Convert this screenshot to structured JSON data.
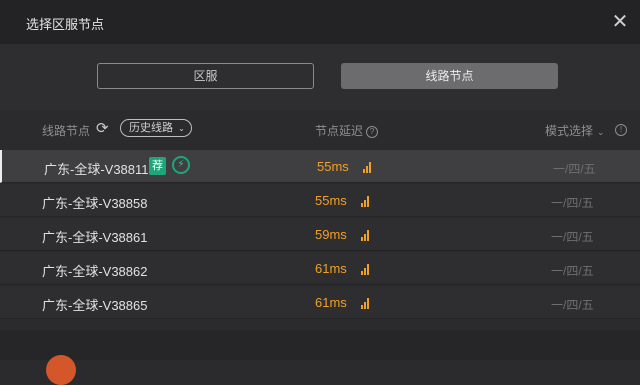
{
  "window": {
    "title": "选择区服节点"
  },
  "tabs": [
    {
      "label": "区服"
    },
    {
      "label": "线路节点"
    }
  ],
  "table": {
    "header": {
      "nodes": "线路节点",
      "history": "历史线路",
      "latency": "节点延迟",
      "mode": "模式选择"
    },
    "rows": [
      {
        "name": "广东-全球-V38811",
        "latency": "55ms",
        "mode": "一/四/五",
        "badge": "荐"
      },
      {
        "name": "广东-全球-V38858",
        "latency": "55ms",
        "mode": "一/四/五"
      },
      {
        "name": "广东-全球-V38861",
        "latency": "59ms",
        "mode": "一/四/五"
      },
      {
        "name": "广东-全球-V38862",
        "latency": "61ms",
        "mode": "一/四/五"
      },
      {
        "name": "广东-全球-V38865",
        "latency": "61ms",
        "mode": "一/四/五"
      }
    ]
  },
  "colors": {
    "accent_green": "#1ea67a",
    "latency_orange": "#f0a028"
  },
  "icons": {
    "close": "close-icon",
    "refresh": "refresh-icon",
    "help": "help-icon",
    "info": "info-icon",
    "boost": "boost-icon",
    "signal": "signal-icon"
  }
}
